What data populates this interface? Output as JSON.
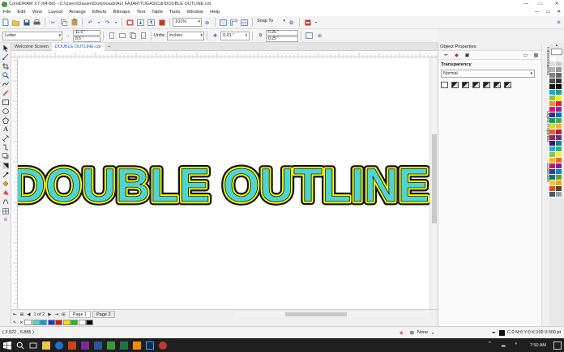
{
  "window": {
    "title": "CorelDRAW X7 (64-Bit) - C:\\Users\\Dasam\\Downloads\\ALI FAJAR\\TUGAS\\Cdr\\DOUBLE OUTLINE.cdr",
    "controls": {
      "minimize": "—",
      "maximize": "▭",
      "close": "✕"
    }
  },
  "menu": {
    "items": [
      {
        "label": "File"
      },
      {
        "label": "Edit"
      },
      {
        "label": "View"
      },
      {
        "label": "Layout"
      },
      {
        "label": "Arrange"
      },
      {
        "label": "Effects"
      },
      {
        "label": "Bitmaps"
      },
      {
        "label": "Text"
      },
      {
        "label": "Table"
      },
      {
        "label": "Tools"
      },
      {
        "label": "Window"
      },
      {
        "label": "Help"
      }
    ],
    "right_controls": {
      "minimize": "—",
      "restore": "▭",
      "close": "✕"
    }
  },
  "toolbar": {
    "zoom": "101%",
    "snap_to": "Snap To"
  },
  "property_bar": {
    "page_size": "Letter",
    "width": "11.0 \"",
    "height": "8.5 \"",
    "units_label": "Units:",
    "units": "inches",
    "nudge": "0.01 \"",
    "dup_x": "0.25 \"",
    "dup_y": "0.25 \""
  },
  "tabs": [
    {
      "label": "Welcome Screen",
      "active": false
    },
    {
      "label": "DOUBLE OUTLINE.cdr",
      "active": true
    }
  ],
  "canvas": {
    "artwork_text": "DOUBLE OUTLINE",
    "fill_color": "#4fd4d0",
    "inner_outline_color": "#ffff00",
    "outer_outline_color": "#111111"
  },
  "page_nav": {
    "page_count": "1 of 2",
    "pages": [
      "Page 1",
      "Page 2"
    ]
  },
  "document_palette": [
    "#ffffff",
    "#4fd4d0",
    "#00a0e0",
    "#1e3cc8",
    "#e01010",
    "#f0e000",
    "#18c018",
    "#ffffff",
    "#000000"
  ],
  "docker": {
    "title": "Object Properties",
    "section": "Transparency",
    "mode": "Normal",
    "vertical_tabs": [
      "Transformations",
      "Object Properties",
      "Guidelines"
    ]
  },
  "color_palette": [
    "#ffffff",
    "#f2f2f2",
    "#e0e0e0",
    "#cccccc",
    "#b3b3b3",
    "#999999",
    "#808080",
    "#666666",
    "#4d4d4d",
    "#333333",
    "#1a1a1a",
    "#000000",
    "#00aeef",
    "#00a99d",
    "#8dc63f",
    "#fff200",
    "#f7941d",
    "#ed1c24",
    "#ec008c",
    "#92278f",
    "#2e3192",
    "#0072bc",
    "#00a651",
    "#39b54a",
    "#d7df23",
    "#fbb040",
    "#f15a29",
    "#be1e2d",
    "#9e1f63",
    "#662d91",
    "#262262",
    "#1b75bc",
    "#27aae1",
    "#2bb673",
    "#8cc63f",
    "#f9ed32",
    "#fdb913",
    "#f26522",
    "#c2185b",
    "#7b1fa2",
    "#303f9f",
    "#0288d1",
    "#00796b",
    "#689f38",
    "#fbc02d",
    "#ffa000",
    "#e64a19",
    "#5d4037",
    "#455a64",
    "#90a4ae"
  ],
  "status": {
    "coords": "( 3.022 , 6.885 )",
    "fill_none": "None",
    "outline_info": "C:0 M:0 Y:0 K:100  0.500 pt"
  },
  "taskbar": {
    "time": "7:50 AM"
  }
}
